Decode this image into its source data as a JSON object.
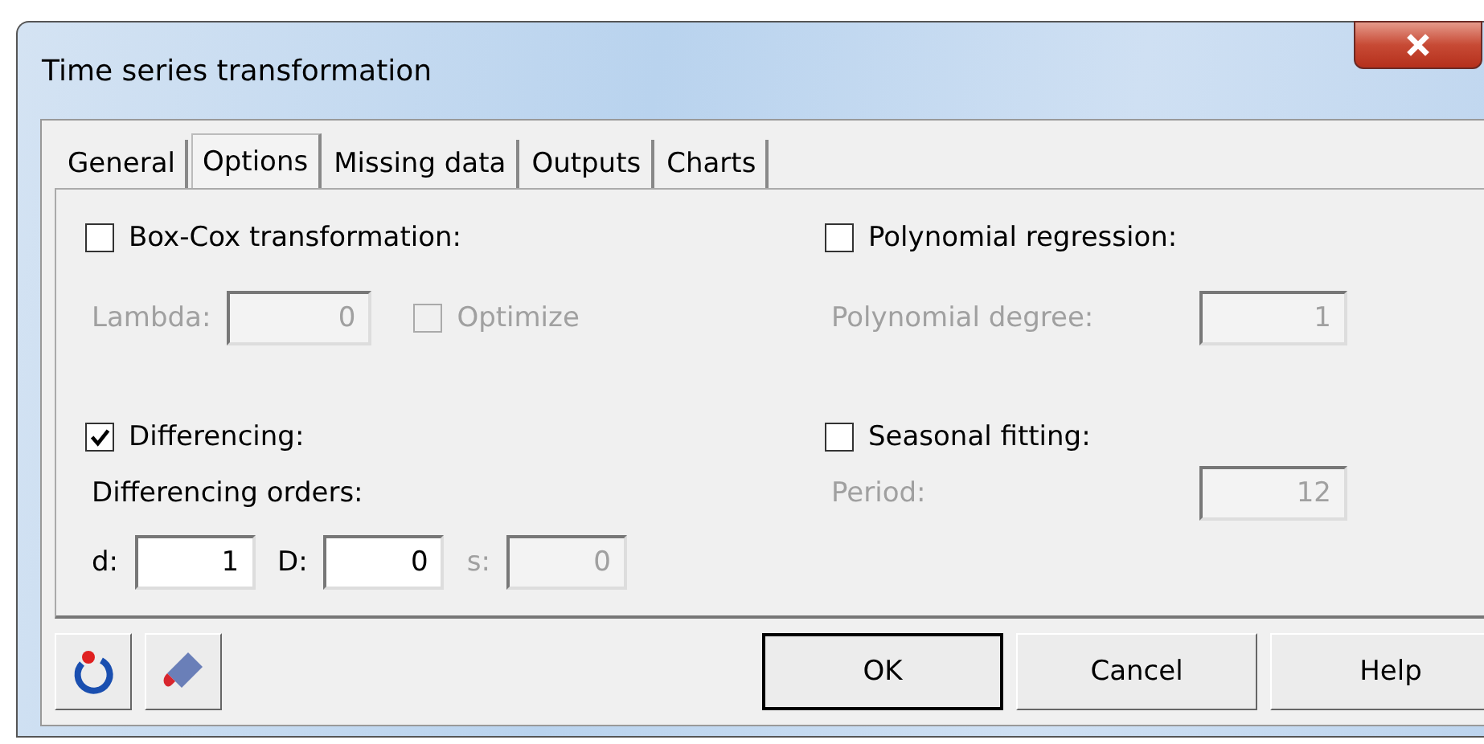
{
  "window": {
    "title": "Time series transformation"
  },
  "tabs": [
    {
      "label": "General",
      "selected": false
    },
    {
      "label": "Options",
      "selected": true
    },
    {
      "label": "Missing data",
      "selected": false
    },
    {
      "label": "Outputs",
      "selected": false
    },
    {
      "label": "Charts",
      "selected": false
    }
  ],
  "box_cox": {
    "label": "Box-Cox transformation:",
    "checked": false
  },
  "lambda": {
    "label": "Lambda:",
    "value": "0",
    "disabled": true
  },
  "optimize": {
    "label": "Optimize",
    "checked": false,
    "disabled": true
  },
  "polynomial": {
    "label": "Polynomial regression:",
    "checked": false
  },
  "polynomial_degree": {
    "label": "Polynomial degree:",
    "value": "1",
    "disabled": true
  },
  "differencing": {
    "label": "Differencing:",
    "checked": true
  },
  "differencing_orders": {
    "label": "Differencing orders:"
  },
  "orders": [
    {
      "label": "d:",
      "value": "1",
      "disabled": false
    },
    {
      "label": "D:",
      "value": "0",
      "disabled": false
    },
    {
      "label": "s:",
      "value": "0",
      "disabled": true
    }
  ],
  "seasonal": {
    "label": "Seasonal fitting:",
    "checked": false
  },
  "period": {
    "label": "Period:",
    "value": "12",
    "disabled": true
  },
  "buttons": [
    {
      "label": "OK",
      "default": true
    },
    {
      "label": "Cancel",
      "default": false
    },
    {
      "label": "Help",
      "default": false
    }
  ]
}
